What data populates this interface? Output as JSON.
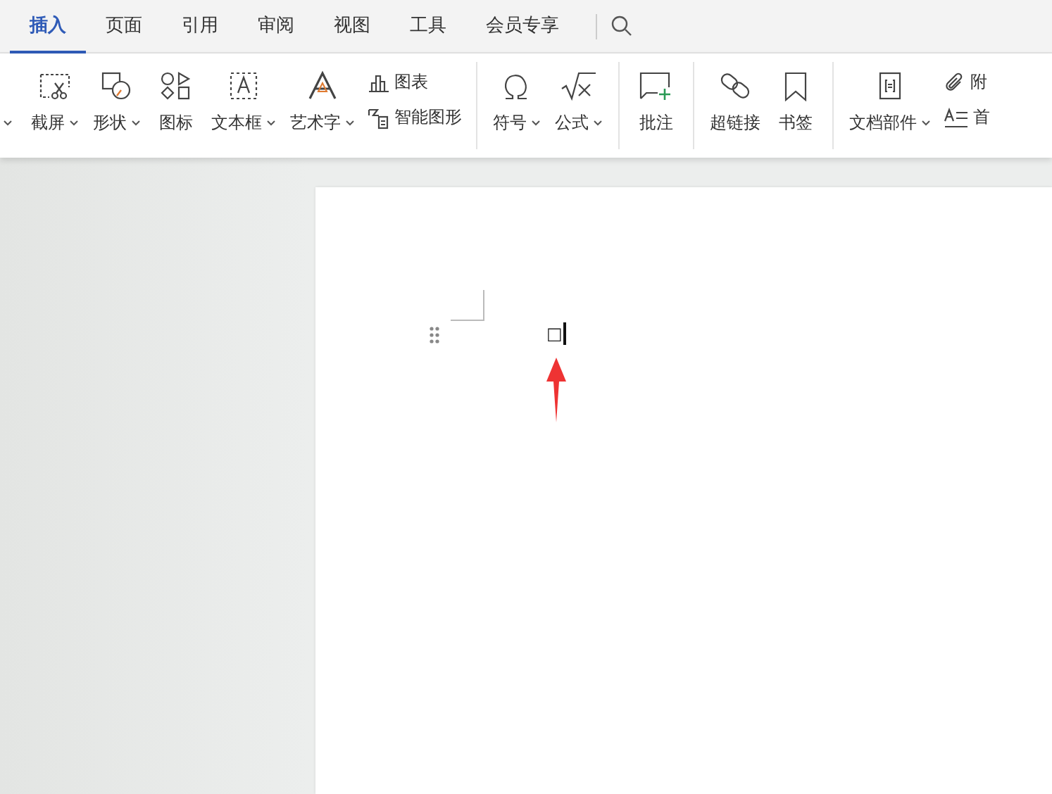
{
  "tabs": [
    {
      "label": "插入",
      "selected": true
    },
    {
      "label": "页面",
      "selected": false
    },
    {
      "label": "引用",
      "selected": false
    },
    {
      "label": "审阅",
      "selected": false
    },
    {
      "label": "视图",
      "selected": false
    },
    {
      "label": "工具",
      "selected": false
    },
    {
      "label": "会员专享",
      "selected": false
    }
  ],
  "ribbon": {
    "groups": [
      {
        "items": [
          {
            "kind": "large",
            "label": "截屏",
            "dropdown": true
          },
          {
            "kind": "large",
            "label": "形状",
            "dropdown": true
          },
          {
            "kind": "large",
            "label": "图标",
            "dropdown": false
          },
          {
            "kind": "large",
            "label": "文本框",
            "dropdown": true
          },
          {
            "kind": "large",
            "label": "艺术字",
            "dropdown": true
          },
          {
            "kind": "small",
            "label": "图表",
            "dropdown": false
          },
          {
            "kind": "small",
            "label": "智能图形",
            "dropdown": false
          }
        ]
      },
      {
        "items": [
          {
            "kind": "large",
            "label": "符号",
            "dropdown": true
          },
          {
            "kind": "large",
            "label": "公式",
            "dropdown": true
          }
        ]
      },
      {
        "items": [
          {
            "kind": "large",
            "label": "批注",
            "dropdown": false
          }
        ]
      },
      {
        "items": [
          {
            "kind": "large",
            "label": "超链接",
            "dropdown": false
          },
          {
            "kind": "large",
            "label": "书签",
            "dropdown": false
          }
        ]
      },
      {
        "items": [
          {
            "kind": "large",
            "label": "文档部件",
            "dropdown": true
          },
          {
            "kind": "small",
            "label": "附",
            "dropdown": false
          },
          {
            "kind": "small",
            "label": "首",
            "dropdown": false
          }
        ]
      }
    ]
  },
  "document": {
    "text": "□"
  }
}
